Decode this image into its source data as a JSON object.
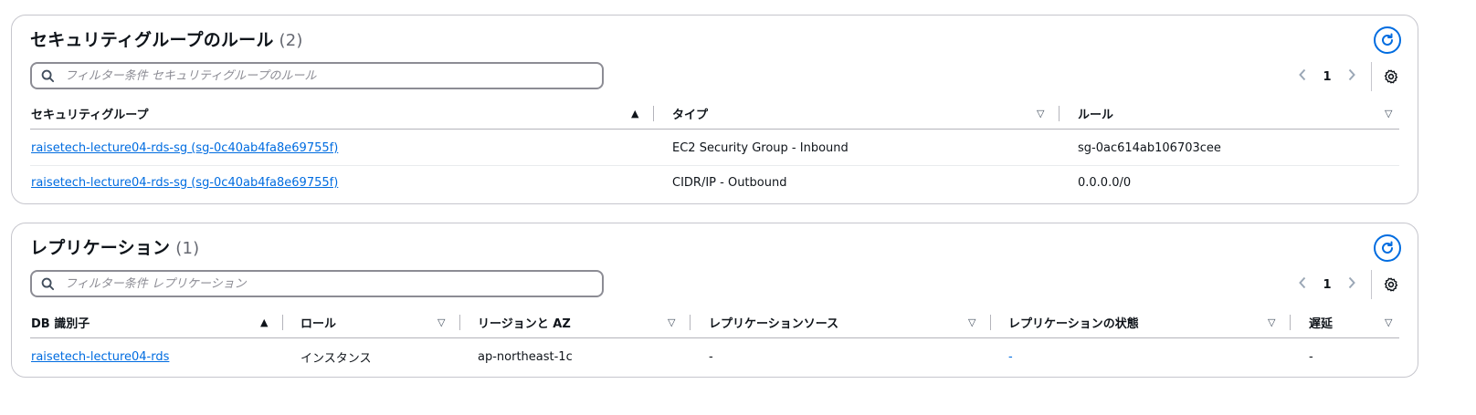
{
  "sg_panel": {
    "title": "セキュリティグループのルール",
    "count": "(2)",
    "search_placeholder": "フィルター条件 セキュリティグループのルール",
    "page": "1",
    "columns": [
      "セキュリティグループ",
      "タイプ",
      "ルール"
    ],
    "rows": [
      {
        "group": "raisetech-lecture04-rds-sg (sg-0c40ab4fa8e69755f)",
        "type": "EC2 Security Group - Inbound",
        "rule": "sg-0ac614ab106703cee"
      },
      {
        "group": "raisetech-lecture04-rds-sg (sg-0c40ab4fa8e69755f)",
        "type": "CIDR/IP - Outbound",
        "rule": "0.0.0.0/0"
      }
    ]
  },
  "rep_panel": {
    "title": "レプリケーション",
    "count": "(1)",
    "search_placeholder": "フィルター条件 レプリケーション",
    "page": "1",
    "columns": [
      "DB 識別子",
      "ロール",
      "リージョンと AZ",
      "レプリケーションソース",
      "レプリケーションの状態",
      "遅延"
    ],
    "rows": [
      {
        "db_id": "raisetech-lecture04-rds",
        "role": "インスタンス",
        "region_az": "ap-northeast-1c",
        "source": "-",
        "state": "-",
        "lag": "-"
      }
    ]
  },
  "icons": {
    "refresh": "refresh-icon",
    "search": "search-icon",
    "settings": "gear-icon",
    "prev": "chevron-left-icon",
    "next": "chevron-right-icon",
    "sort_asc": "sort-ascending-icon",
    "sort_none": "sort-descending-icon"
  },
  "colors": {
    "link": "#006ce0",
    "border": "#c6c6cd",
    "text": "#0f141a"
  }
}
